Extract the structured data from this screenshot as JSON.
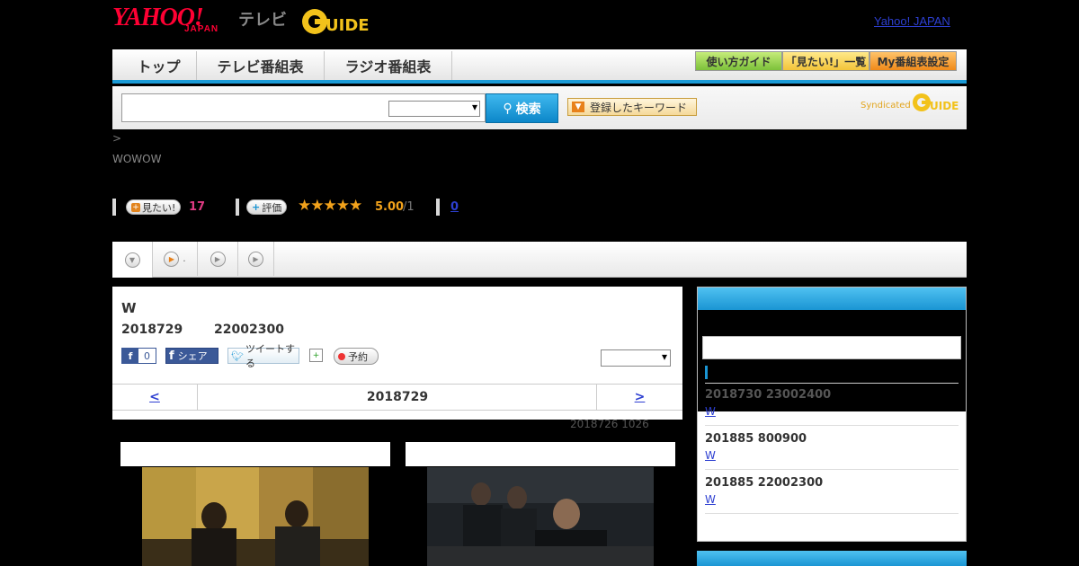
{
  "header": {
    "yahoo_logo": "YAHOO!",
    "japan_logo": "JAPAN",
    "tv_label": "テレビ",
    "gguide_logo": "G-GUIDE",
    "top_link": "Yahoo! JAPAN"
  },
  "nav": {
    "tabs": [
      "トップ",
      "テレビ番組表",
      "ラジオ番組表"
    ],
    "right_buttons": [
      "使い方ガイド",
      "「見たい!」一覧",
      "My番組表設定"
    ]
  },
  "search": {
    "button_label": "検索",
    "keyword_button": "登録したキーワード",
    "syndicated": "Syndicated"
  },
  "breadcrumb": ">",
  "channel": "WOWOW",
  "rating": {
    "want_button": "見たい!",
    "want_count": "17",
    "rate_button": "評価",
    "stars": "★★★★★",
    "score": "5.00",
    "score_den": "/1",
    "comment_count": "0"
  },
  "program": {
    "title": "W",
    "date": "2018729",
    "time": "22002300",
    "fb_like_count": "0",
    "fb_share": "シェア",
    "tweet": "ツイートする",
    "record": "予約",
    "nav_prev": "<",
    "nav_date": "2018729",
    "nav_next": ">",
    "updated": "2018726  1026"
  },
  "sidebar": {
    "items": [
      {
        "date": "2018730  23002400",
        "link": "W"
      },
      {
        "date": "201885  800900",
        "link": "W"
      },
      {
        "date": "201885  22002300",
        "link": "W"
      }
    ]
  },
  "colors": {
    "accent_blue": "#1a95d3",
    "link_blue": "#2d3fd1",
    "star_orange": "#f2a21b",
    "want_pink": "#e03b83",
    "yahoo_red": "#ff0033"
  }
}
